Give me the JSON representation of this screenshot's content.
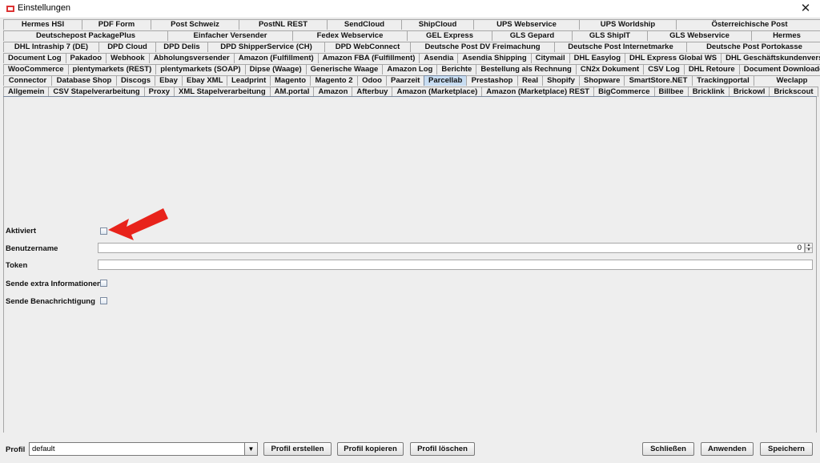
{
  "window": {
    "title": "Einstellungen",
    "close": "✕"
  },
  "tabs": {
    "row1": [
      "Hermes HSI",
      "PDF Form",
      "Post Schweiz",
      "PostNL REST",
      "SendCloud",
      "ShipCloud",
      "UPS Webservice",
      "UPS Worldship",
      "Österreichische Post"
    ],
    "row2": [
      "Deutschepost PackagePlus",
      "Einfacher Versender",
      "Fedex Webservice",
      "GEL Express",
      "GLS Gepard",
      "GLS ShipIT",
      "GLS Webservice",
      "Hermes"
    ],
    "row3": [
      "DHL Intraship 7 (DE)",
      "DPD Cloud",
      "DPD Delis",
      "DPD ShipperService (CH)",
      "DPD WebConnect",
      "Deutsche Post DV Freimachung",
      "Deutsche Post Internetmarke",
      "Deutsche Post Portokasse"
    ],
    "row4": [
      "Document Log",
      "Pakadoo",
      "Webhook",
      "Abholungsversender",
      "Amazon (Fulfillment)",
      "Amazon FBA (Fulfillment)",
      "Asendia",
      "Asendia Shipping",
      "Citymail",
      "DHL Easylog",
      "DHL Express Global WS",
      "DHL Geschäftskundenversand"
    ],
    "row5": [
      "WooCommerce",
      "plentymarkets (REST)",
      "plentymarkets (SOAP)",
      "Dipse (Waage)",
      "Generische Waage",
      "Amazon Log",
      "Berichte",
      "Bestellung als Rechnung",
      "CN2x Dokument",
      "CSV Log",
      "DHL Retoure",
      "Document Downloader"
    ],
    "row6": [
      "Connector",
      "Database Shop",
      "Discogs",
      "Ebay",
      "Ebay XML",
      "Leadprint",
      "Magento",
      "Magento 2",
      "Odoo",
      "Paarzeit",
      "Parcellab",
      "Prestashop",
      "Real",
      "Shopify",
      "Shopware",
      "SmartStore.NET",
      "Trackingportal",
      "Weclapp"
    ],
    "row7": [
      "Allgemein",
      "CSV Stapelverarbeitung",
      "Proxy",
      "XML Stapelverarbeitung",
      "AM.portal",
      "Amazon",
      "Afterbuy",
      "Amazon (Marketplace)",
      "Amazon (Marketplace) REST",
      "BigCommerce",
      "Billbee",
      "Bricklink",
      "Brickowl",
      "Brickscout"
    ],
    "selected": "Parcellab"
  },
  "form": {
    "aktiviert_label": "Aktiviert",
    "benutzername_label": "Benutzername",
    "benutzername_value": "0",
    "token_label": "Token",
    "token_value": "",
    "extra_label": "Sende extra Informationen",
    "benachrichtigung_label": "Sende Benachrichtigung"
  },
  "bottom": {
    "profil_label": "Profil",
    "profil_value": "default",
    "profil_erstellen": "Profil erstellen",
    "profil_kopieren": "Profil kopieren",
    "profil_loeschen": "Profil löschen",
    "schliessen": "Schließen",
    "anwenden": "Anwenden",
    "speichern": "Speichern"
  },
  "colors": {
    "selected_tab": "#c8ddf2",
    "annotation_arrow": "#e8231b"
  }
}
